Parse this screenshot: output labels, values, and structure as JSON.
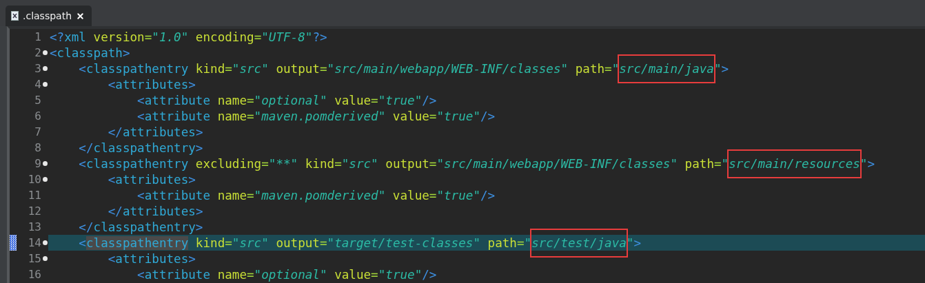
{
  "tab": {
    "label": ".classpath",
    "selected": true
  },
  "lines": [
    {
      "number": "1",
      "foldable": false,
      "current": false,
      "tokens": [
        {
          "kind": "punct",
          "text": "<?"
        },
        {
          "kind": "tag",
          "text": "xml"
        },
        {
          "kind": "attr",
          "text": " version"
        },
        {
          "kind": "eq",
          "text": "="
        },
        {
          "kind": "str",
          "text": "\"1.0\""
        },
        {
          "kind": "attr",
          "text": " encoding"
        },
        {
          "kind": "eq",
          "text": "="
        },
        {
          "kind": "str",
          "text": "\"UTF-8\""
        },
        {
          "kind": "punct",
          "text": "?>"
        }
      ]
    },
    {
      "number": "2",
      "foldable": true,
      "current": false,
      "tokens": [
        {
          "kind": "punct",
          "text": "<"
        },
        {
          "kind": "tag",
          "text": "classpath"
        },
        {
          "kind": "punct",
          "text": ">"
        }
      ]
    },
    {
      "number": "3",
      "foldable": true,
      "current": false,
      "tokens": [
        {
          "kind": "punct",
          "text": "    <"
        },
        {
          "kind": "tag",
          "text": "classpathentry"
        },
        {
          "kind": "attr",
          "text": " kind"
        },
        {
          "kind": "eq",
          "text": "="
        },
        {
          "kind": "str",
          "text": "\"src\""
        },
        {
          "kind": "attr",
          "text": " output"
        },
        {
          "kind": "eq",
          "text": "="
        },
        {
          "kind": "str",
          "text": "\"src/main/webapp/WEB-INF/classes\""
        },
        {
          "kind": "attr",
          "text": " path"
        },
        {
          "kind": "eq",
          "text": "="
        },
        {
          "kind": "str",
          "text": "\""
        },
        {
          "kind": "str",
          "text": "src/main/java",
          "boxed": true
        },
        {
          "kind": "str",
          "text": "\""
        },
        {
          "kind": "punct",
          "text": ">"
        }
      ]
    },
    {
      "number": "4",
      "foldable": true,
      "current": false,
      "tokens": [
        {
          "kind": "punct",
          "text": "        <"
        },
        {
          "kind": "tag",
          "text": "attributes"
        },
        {
          "kind": "punct",
          "text": ">"
        }
      ]
    },
    {
      "number": "5",
      "foldable": false,
      "current": false,
      "tokens": [
        {
          "kind": "punct",
          "text": "            <"
        },
        {
          "kind": "tag",
          "text": "attribute"
        },
        {
          "kind": "attr",
          "text": " name"
        },
        {
          "kind": "eq",
          "text": "="
        },
        {
          "kind": "str",
          "text": "\"optional\""
        },
        {
          "kind": "attr",
          "text": " value"
        },
        {
          "kind": "eq",
          "text": "="
        },
        {
          "kind": "str",
          "text": "\"true\""
        },
        {
          "kind": "punct",
          "text": "/>"
        }
      ]
    },
    {
      "number": "6",
      "foldable": false,
      "current": false,
      "tokens": [
        {
          "kind": "punct",
          "text": "            <"
        },
        {
          "kind": "tag",
          "text": "attribute"
        },
        {
          "kind": "attr",
          "text": " name"
        },
        {
          "kind": "eq",
          "text": "="
        },
        {
          "kind": "str",
          "text": "\"maven.pomderived\""
        },
        {
          "kind": "attr",
          "text": " value"
        },
        {
          "kind": "eq",
          "text": "="
        },
        {
          "kind": "str",
          "text": "\"true\""
        },
        {
          "kind": "punct",
          "text": "/>"
        }
      ]
    },
    {
      "number": "7",
      "foldable": false,
      "current": false,
      "tokens": [
        {
          "kind": "punct",
          "text": "        </"
        },
        {
          "kind": "tag",
          "text": "attributes"
        },
        {
          "kind": "punct",
          "text": ">"
        }
      ]
    },
    {
      "number": "8",
      "foldable": false,
      "current": false,
      "tokens": [
        {
          "kind": "punct",
          "text": "    </"
        },
        {
          "kind": "tag",
          "text": "classpathentry"
        },
        {
          "kind": "punct",
          "text": ">"
        }
      ]
    },
    {
      "number": "9",
      "foldable": true,
      "current": false,
      "tokens": [
        {
          "kind": "punct",
          "text": "    <"
        },
        {
          "kind": "tag",
          "text": "classpathentry"
        },
        {
          "kind": "attr",
          "text": " excluding"
        },
        {
          "kind": "eq",
          "text": "="
        },
        {
          "kind": "str",
          "text": "\"**\""
        },
        {
          "kind": "attr",
          "text": " kind"
        },
        {
          "kind": "eq",
          "text": "="
        },
        {
          "kind": "str",
          "text": "\"src\""
        },
        {
          "kind": "attr",
          "text": " output"
        },
        {
          "kind": "eq",
          "text": "="
        },
        {
          "kind": "str",
          "text": "\"src/main/webapp/WEB-INF/classes\""
        },
        {
          "kind": "attr",
          "text": " path"
        },
        {
          "kind": "eq",
          "text": "="
        },
        {
          "kind": "str",
          "text": "\""
        },
        {
          "kind": "str",
          "text": "src/main/resources",
          "boxed": true
        },
        {
          "kind": "str",
          "text": "\""
        },
        {
          "kind": "punct",
          "text": ">"
        }
      ]
    },
    {
      "number": "10",
      "foldable": true,
      "current": false,
      "tokens": [
        {
          "kind": "punct",
          "text": "        <"
        },
        {
          "kind": "tag",
          "text": "attributes"
        },
        {
          "kind": "punct",
          "text": ">"
        }
      ]
    },
    {
      "number": "11",
      "foldable": false,
      "current": false,
      "tokens": [
        {
          "kind": "punct",
          "text": "            <"
        },
        {
          "kind": "tag",
          "text": "attribute"
        },
        {
          "kind": "attr",
          "text": " name"
        },
        {
          "kind": "eq",
          "text": "="
        },
        {
          "kind": "str",
          "text": "\"maven.pomderived\""
        },
        {
          "kind": "attr",
          "text": " value"
        },
        {
          "kind": "eq",
          "text": "="
        },
        {
          "kind": "str",
          "text": "\"true\""
        },
        {
          "kind": "punct",
          "text": "/>"
        }
      ]
    },
    {
      "number": "12",
      "foldable": false,
      "current": false,
      "tokens": [
        {
          "kind": "punct",
          "text": "        </"
        },
        {
          "kind": "tag",
          "text": "attributes"
        },
        {
          "kind": "punct",
          "text": ">"
        }
      ]
    },
    {
      "number": "13",
      "foldable": false,
      "current": false,
      "tokens": [
        {
          "kind": "punct",
          "text": "    </"
        },
        {
          "kind": "tag",
          "text": "classpathentry"
        },
        {
          "kind": "punct",
          "text": ">"
        }
      ]
    },
    {
      "number": "14",
      "foldable": true,
      "current": true,
      "tokens": [
        {
          "kind": "punct",
          "text": "    <"
        },
        {
          "kind": "tag",
          "text": "classpathentry",
          "occurrence": true
        },
        {
          "kind": "attr",
          "text": " kind"
        },
        {
          "kind": "eq",
          "text": "="
        },
        {
          "kind": "str",
          "text": "\"src\""
        },
        {
          "kind": "attr",
          "text": " output"
        },
        {
          "kind": "eq",
          "text": "="
        },
        {
          "kind": "str",
          "text": "\"target/test-classes\""
        },
        {
          "kind": "attr",
          "text": " path"
        },
        {
          "kind": "eq",
          "text": "="
        },
        {
          "kind": "str",
          "text": "\""
        },
        {
          "kind": "str",
          "text": "src/test/java",
          "boxed": true
        },
        {
          "kind": "str",
          "text": "\""
        },
        {
          "kind": "punct",
          "text": ">"
        }
      ]
    },
    {
      "number": "15",
      "foldable": true,
      "current": false,
      "tokens": [
        {
          "kind": "punct",
          "text": "        <"
        },
        {
          "kind": "tag",
          "text": "attributes"
        },
        {
          "kind": "punct",
          "text": ">"
        }
      ]
    },
    {
      "number": "16",
      "foldable": false,
      "current": false,
      "tokens": [
        {
          "kind": "punct",
          "text": "            <"
        },
        {
          "kind": "tag",
          "text": "attribute"
        },
        {
          "kind": "attr",
          "text": " name"
        },
        {
          "kind": "eq",
          "text": "="
        },
        {
          "kind": "str",
          "text": "\"optional\""
        },
        {
          "kind": "attr",
          "text": " value"
        },
        {
          "kind": "eq",
          "text": "="
        },
        {
          "kind": "str",
          "text": "\"true\""
        },
        {
          "kind": "punct",
          "text": "/>"
        }
      ]
    }
  ]
}
